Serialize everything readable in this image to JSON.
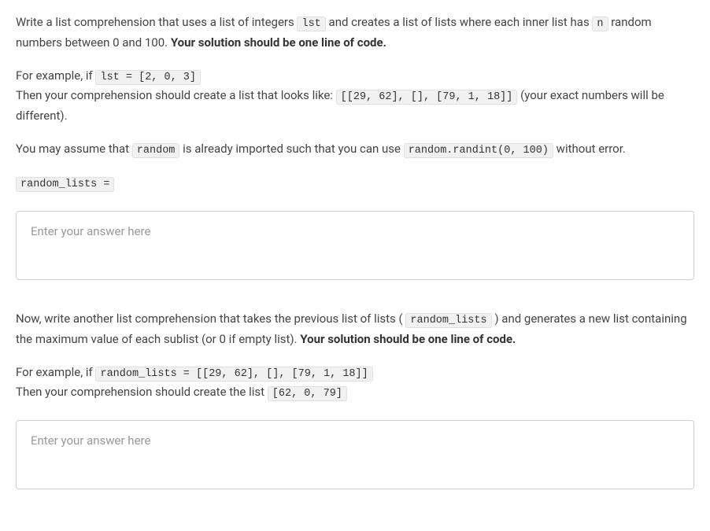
{
  "q1": {
    "para1_pre": "Write a list comprehension that uses a list of integers ",
    "code_lst": "lst",
    "para1_mid": " and creates a list of lists where each inner list has ",
    "code_n": "n",
    "para1_post": " random numbers between 0 and 100. ",
    "bold1": "Your solution should be one line of code.",
    "example_pre": "For example, if ",
    "example_code": "lst = [2, 0, 3]",
    "example_then": "Then your comprehension should create a list that looks like: ",
    "example_result": "[[29, 62], [], [79, 1, 18]]",
    "example_note": " (your exact numbers will be different).",
    "assume_pre": "You may assume that ",
    "assume_code1": "random",
    "assume_mid": " is already imported such that you can use ",
    "assume_code2": "random.randint(0, 100)",
    "assume_post": " without error.",
    "assign_code": "random_lists =",
    "placeholder": "Enter your answer here"
  },
  "q2": {
    "para1_pre": "Now, write another list comprehension that takes the previous list of lists (",
    "code_rl": "random_lists",
    "para1_mid": ") and generates a new list containing the maximum value of each sublist (or 0 if empty list). ",
    "bold1": "Your solution should be one line of code.",
    "example_pre": "For example, if ",
    "example_code": "random_lists = [[29, 62], [], [79, 1, 18]]",
    "example_then": "Then your comprehension should create the list ",
    "example_result": "[62, 0, 79]",
    "placeholder": "Enter your answer here"
  }
}
